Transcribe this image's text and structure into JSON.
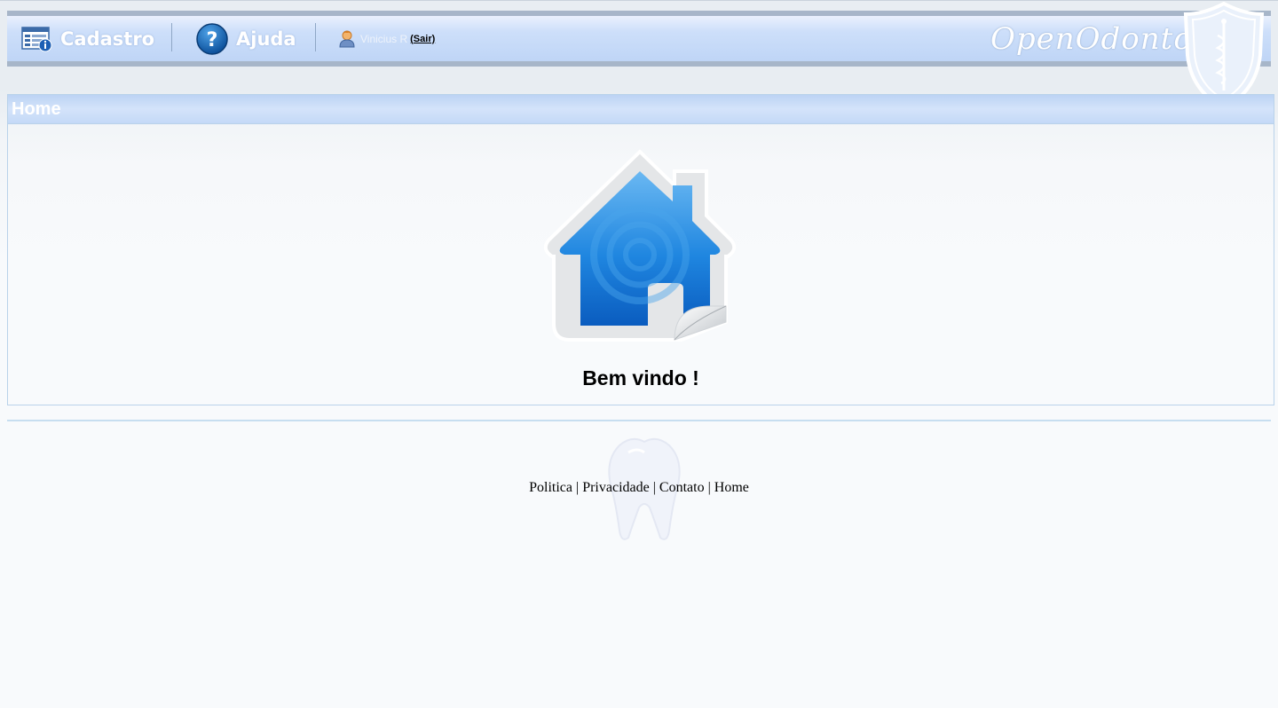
{
  "header": {
    "menu": [
      {
        "label": "Cadastro",
        "icon": "register-form-icon"
      },
      {
        "label": "Ajuda",
        "icon": "help-question-icon"
      }
    ],
    "user": {
      "name": "Vinicius R",
      "logout_label": "(Sair)",
      "icon": "user-avatar-icon"
    },
    "brand": "OpenOdonto",
    "brand_icon": "shield-caduceus-icon"
  },
  "panel": {
    "title": "Home",
    "image": "home-house-icon",
    "welcome": "Bem vindo !"
  },
  "footer": {
    "links": [
      "Politica",
      "Privacidade",
      "Contato",
      "Home"
    ],
    "separator": "|",
    "watermark": "tooth-watermark-icon"
  },
  "colors": {
    "header_bar": "#bfd5f6",
    "header_border": "#a7b6c9",
    "panel_border": "#b9d2ea",
    "house_blue": "#1a7fd9"
  }
}
